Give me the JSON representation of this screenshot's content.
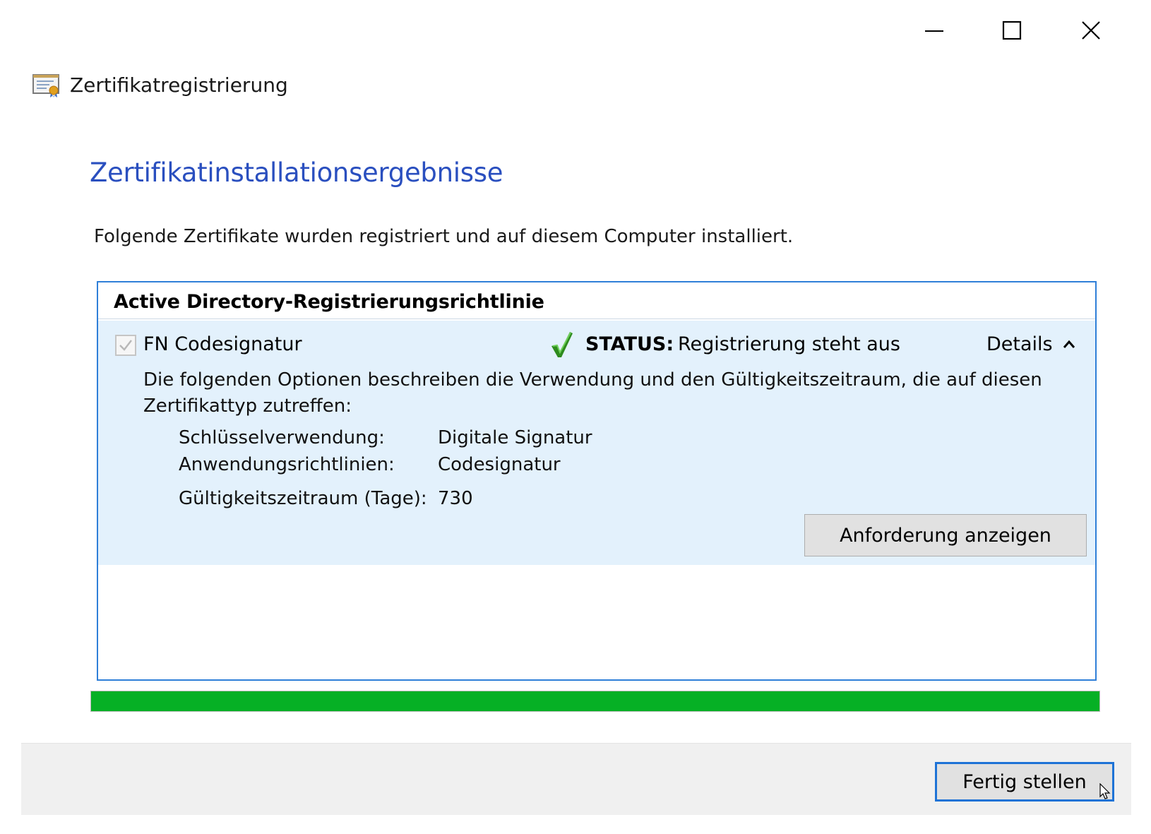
{
  "window": {
    "title": "Zertifikatregistrierung",
    "controls": {
      "minimize_icon": "minimize-icon",
      "maximize_icon": "maximize-icon",
      "close_icon": "close-icon"
    },
    "title_icon": "certificate-icon"
  },
  "page": {
    "heading": "Zertifikatinstallationsergebnisse",
    "intro": "Folgende Zertifikate wurden registriert und auf diesem Computer installiert."
  },
  "policy_group": {
    "header": "Active Directory-Registrierungsrichtlinie",
    "items": [
      {
        "name": "FN Codesignatur",
        "checked": true,
        "status_label": "STATUS:",
        "status_value": "Registrierung steht aus",
        "status_icon": "green-check-icon",
        "details_label": "Details",
        "details_icon": "chevron-up-icon",
        "description": "Die folgenden Optionen beschreiben die Verwendung und den Gültigkeitszeitraum, die auf diesen Zertifikattyp zutreffen:",
        "properties": [
          {
            "key": "Schlüsselverwendung:",
            "value": "Digitale Signatur"
          },
          {
            "key": "Anwendungsrichtlinien:",
            "value": "Codesignatur"
          },
          {
            "key": "Gültigkeitszeitraum (Tage):",
            "value": "730"
          }
        ],
        "view_request_button": "Anforderung anzeigen"
      }
    ]
  },
  "progress": {
    "percent": 100,
    "color": "#06b025"
  },
  "footer": {
    "finish_button": "Fertig stellen"
  },
  "colors": {
    "heading": "#2a4fbf",
    "selection_bg": "#e3f1fc",
    "focus_border": "#1e73d6"
  }
}
